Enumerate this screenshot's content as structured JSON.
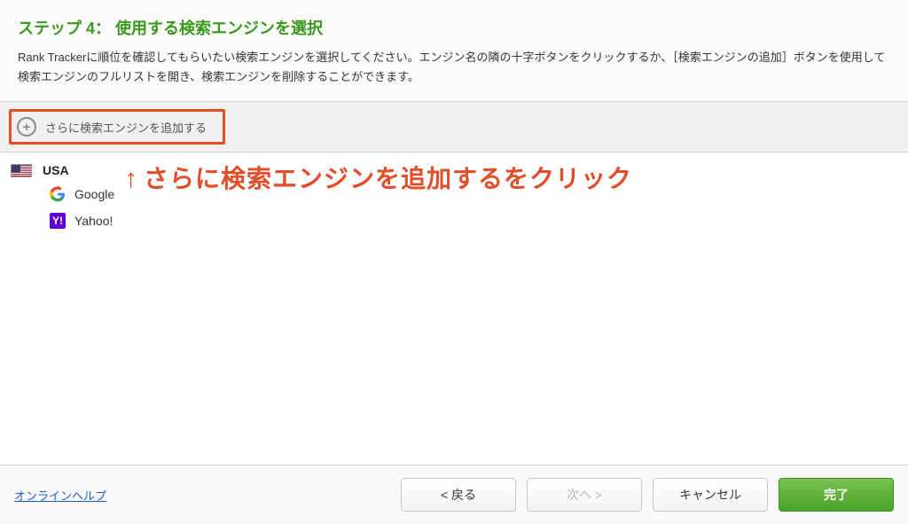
{
  "header": {
    "step_title": "ステップ 4： 使用する検索エンジンを選択",
    "description": "Rank Trackerに順位を確認してもらいたい検索エンジンを選択してください。エンジン名の隣の十字ボタンをクリックするか、［検索エンジンの追加］ボタンを使用して検索エンジンのフルリストを開き、検索エンジンを削除することができます。"
  },
  "add_bar": {
    "label": "さらに検索エンジンを追加する"
  },
  "list": {
    "country": "USA",
    "engines": [
      {
        "name": "Google",
        "icon": "google-icon"
      },
      {
        "name": "Yahoo!",
        "icon": "yahoo-icon"
      }
    ]
  },
  "annotation": {
    "arrow": "↑",
    "text": "さらに検索エンジンを追加するをクリック"
  },
  "footer": {
    "help": "オンラインヘルプ",
    "back": "< 戻る",
    "next": "次へ >",
    "cancel": "キャンセル",
    "done": "完了"
  },
  "yahoo_glyph": "Y!"
}
